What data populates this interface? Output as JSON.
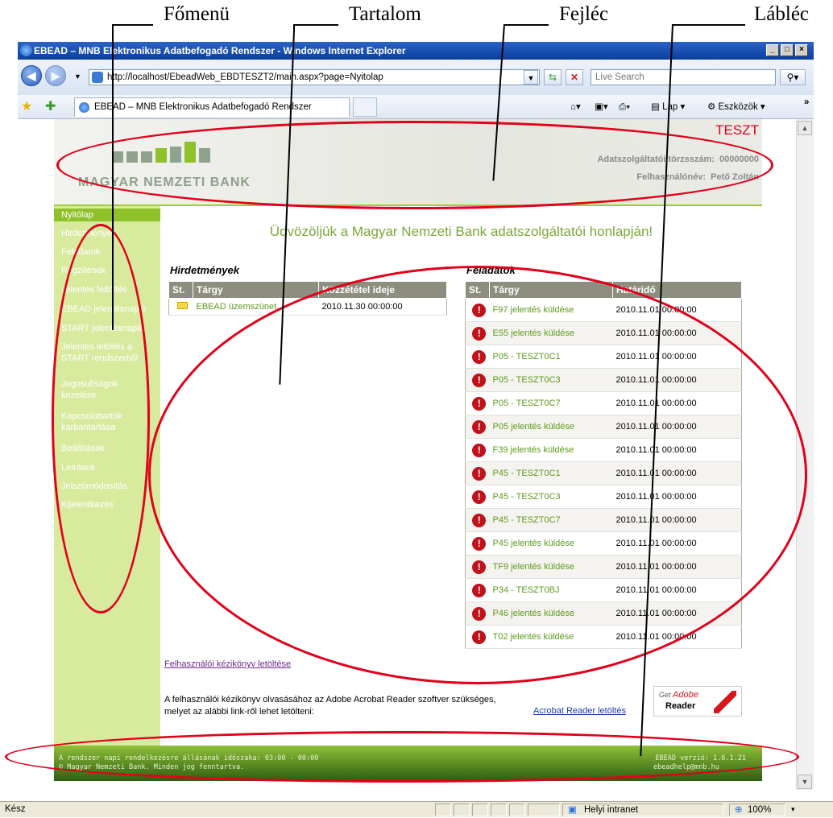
{
  "annotations": {
    "menu": "Főmenü",
    "content": "Tartalom",
    "header": "Fejléc",
    "footer": "Lábléc"
  },
  "window": {
    "title": "EBEAD – MNB Elektronikus Adatbefogadó Rendszer - Windows Internet Explorer",
    "minimize": "_",
    "maximize": "□",
    "close": "×"
  },
  "browser": {
    "address": "http://localhost/EbeadWeb_EBDTESZT2/main.aspx?page=Nyitolap",
    "search_placeholder": "Live Search",
    "tab_title": "EBEAD – MNB Elektronikus Adatbefogadó Rendszer",
    "cmd_page": "Lap",
    "cmd_tools": "Eszközök",
    "more": "»"
  },
  "header": {
    "env": "TESZT",
    "logo_text": "MAGYAR NEMZETI BANK",
    "provider_label": "Adatszolgáltatói törzsszám:",
    "provider_value": "00000000",
    "user_label": "Felhasználónév:",
    "user_value": "Pető Zoltán"
  },
  "sidebar": {
    "items": [
      "Nyitólap",
      "Hirdetmények",
      "Feladatok",
      "Rögzítések",
      "Jelentés feltöltés",
      "EBEAD jelentésnapló",
      "START jelentésnapló",
      "Jelentés letöltés a START rendszerből",
      "Jogosultságok kezelése",
      "Kapcsolattartók karbantartása",
      "Beállítások",
      "Leírások",
      "Jelszómódosítás",
      "Kijelentkezés"
    ]
  },
  "main": {
    "welcome": "Üdvözöljük a Magyar Nemzeti Bank adatszolgáltatói honlapján!",
    "notices_title": "Hirdetmények",
    "tasks_title": "Feladatok",
    "notices_headers": [
      "St.",
      "Tárgy",
      "Közzététel ideje"
    ],
    "notices_rows": [
      {
        "subject": "EBEAD üzemszünet",
        "date": "2010.11.30 00:00:00"
      }
    ],
    "tasks_headers": [
      "St.",
      "Tárgy",
      "Határidő"
    ],
    "tasks_rows": [
      {
        "subject": "F97 jelentés küldése",
        "deadline": "2010.11.01 00:00:00"
      },
      {
        "subject": "E55 jelentés küldése",
        "deadline": "2010.11.01 00:00:00"
      },
      {
        "subject": "P05 - TESZT0C1",
        "deadline": "2010.11.01 00:00:00"
      },
      {
        "subject": "P05 - TESZT0C3",
        "deadline": "2010.11.01 00:00:00"
      },
      {
        "subject": "P05 - TESZT0C7",
        "deadline": "2010.11.01 00:00:00"
      },
      {
        "subject": "P05 jelentés küldése",
        "deadline": "2010.11.01 00:00:00"
      },
      {
        "subject": "F39 jelentés küldése",
        "deadline": "2010.11.01 00:00:00"
      },
      {
        "subject": "P45 - TESZT0C1",
        "deadline": "2010.11.01 00:00:00"
      },
      {
        "subject": "P45 - TESZT0C3",
        "deadline": "2010.11.01 00:00:00"
      },
      {
        "subject": "P45 - TESZT0C7",
        "deadline": "2010.11.01 00:00:00"
      },
      {
        "subject": "P45 jelentés küldése",
        "deadline": "2010.11.01 00:00:00"
      },
      {
        "subject": "TF9 jelentés küldése",
        "deadline": "2010.11.01 00:00:00"
      },
      {
        "subject": "P34 - TESZT0BJ",
        "deadline": "2010.11.01 00:00:00"
      },
      {
        "subject": "P46 jelentés küldése",
        "deadline": "2010.11.01 00:00:00"
      },
      {
        "subject": "T02 jelentés küldése",
        "deadline": "2010.11.01 00:00:00"
      }
    ],
    "manual_link": "Felhasználói kézikönyv letöltése",
    "reader_text": "A felhasználói kézikönyv olvasásához az Adobe Acrobat Reader szoftver szükséges, melyet az alábbi link-ről lehet letölteni:",
    "reader_link": "Acrobat Reader letöltés",
    "badge_get": "Get",
    "badge_adobe": "Adobe",
    "badge_reader": "Reader"
  },
  "footer": {
    "line1": "A rendszer napi rendelkezésre állásának időszaka: 03:00 - 00:00",
    "line2": "© Magyar Nemzeti Bank. Minden jog fenntartva.",
    "version": "EBEAD verzió: 1.6.1.21",
    "email": "ebeadhelp@mnb.hu"
  },
  "status": {
    "ready": "Kész",
    "zone": "Helyi intranet",
    "zoom": "100%"
  },
  "colors": {
    "accent": "#8fc12b",
    "sidebar_bg": "#d8ea9e",
    "annotation_red": "#e2001a",
    "task_status": "#c0121b"
  }
}
